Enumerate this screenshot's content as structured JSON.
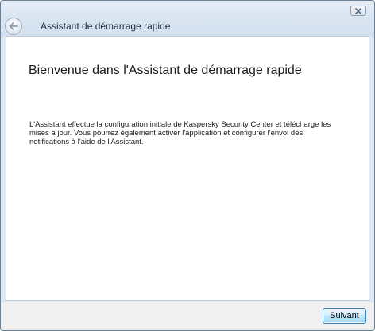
{
  "window": {
    "title": "Assistant de démarrage rapide",
    "back_icon": "back-arrow-icon",
    "close_icon": "close-icon"
  },
  "main": {
    "heading": "Bienvenue dans l'Assistant de démarrage rapide",
    "description": "L'Assistant effectue la configuration initiale de Kaspersky Security Center et télécharge les mises à jour. Vous pourrez également activer l'application et configurer l'envoi des notifications à l'aide de l'Assistant."
  },
  "footer": {
    "next_label": "Suivant"
  },
  "colors": {
    "titlebar": "#dbe6f2",
    "content_bg": "#ffffff",
    "footer_bg": "#f0f0f0",
    "button_border": "#3c7fb1"
  }
}
